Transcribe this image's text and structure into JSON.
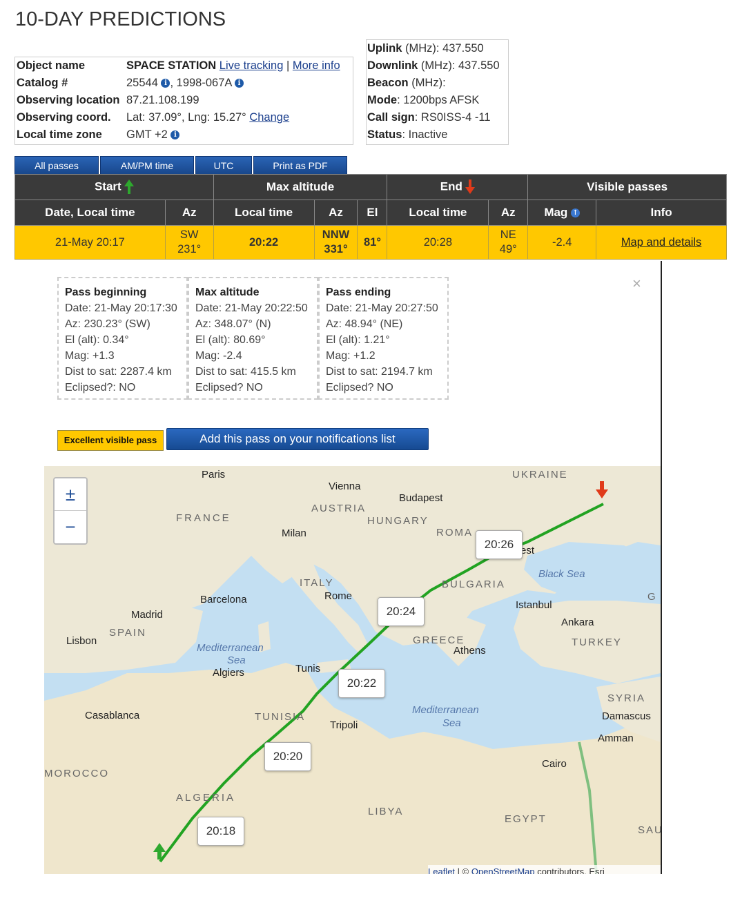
{
  "page_title": "10-DAY PREDICTIONS",
  "object_info": {
    "object_name_label": "Object name",
    "object_name": "SPACE STATION",
    "live_tracking": "Live tracking",
    "separator": "|",
    "more_info": "More info",
    "catalog_label": "Catalog #",
    "catalog_number": "25544",
    "intl_designator": ", 1998-067A",
    "observing_location_label": "Observing location",
    "observing_location": "87.21.108.199",
    "observing_coord_label": "Observing coord.",
    "observing_coord": "Lat: 37.09°, Lng: 15.27°",
    "change_link": "Change",
    "timezone_label": "Local time zone",
    "timezone": "GMT +2"
  },
  "radio": {
    "uplink_label": "Uplink",
    "uplink_value": " (MHz): 437.550",
    "downlink_label": "Downlink",
    "downlink_value": " (MHz): 437.550",
    "beacon_label": "Beacon",
    "beacon_value": " (MHz):",
    "mode_label": "Mode",
    "mode_value": ": 1200bps AFSK",
    "callsign_label": "Call sign",
    "callsign_value": ": RS0ISS-4 -11",
    "status_label": "Status",
    "status_value": ": Inactive"
  },
  "toolbar": {
    "all_passes": "All passes",
    "ampm": "AM/PM time",
    "utc": "UTC",
    "print_pdf": "Print as PDF"
  },
  "passes_table": {
    "group_headers": {
      "start": "Start",
      "max_altitude": "Max altitude",
      "end": "End",
      "visible": "Visible passes"
    },
    "columns": {
      "date_local": "Date, Local time",
      "az1": "Az",
      "local_time_max": "Local time",
      "az_max": "Az",
      "el": "El",
      "local_time_end": "Local time",
      "az_end": "Az",
      "mag": "Mag",
      "info": "Info"
    },
    "row": {
      "date_time": "21-May 20:17",
      "start_dir": "SW",
      "start_az": "231°",
      "max_time": "20:22",
      "max_dir": "NNW",
      "max_az": "331°",
      "max_el": "81°",
      "end_time": "20:28",
      "end_dir": "NE",
      "end_az": "49°",
      "mag": "-2.4",
      "info_link": "Map and details"
    }
  },
  "details": {
    "close": "×",
    "beginning": {
      "title": "Pass beginning",
      "date": "Date: 21-May 20:17:30",
      "az": "Az: 230.23° (SW)",
      "el": "El (alt): 0.34°",
      "mag": "Mag: +1.3",
      "dist": "Dist to sat: 2287.4 km",
      "eclipsed": "Eclipsed?: NO"
    },
    "max": {
      "title": "Max altitude",
      "date": "Date: 21-May 20:22:50",
      "az": "Az: 348.07° (N)",
      "el": "El (alt): 80.69°",
      "mag": "Mag: -2.4",
      "dist": "Dist to sat: 415.5 km",
      "eclipsed": "Eclipsed? NO"
    },
    "ending": {
      "title": "Pass ending",
      "date": "Date: 21-May 20:27:50",
      "az": "Az: 48.94° (NE)",
      "el": "El (alt): 1.21°",
      "mag": "Mag: +1.2",
      "dist": "Dist to sat: 2194.7 km",
      "eclipsed": "Eclipsed? NO"
    },
    "badge": "Excellent visible pass",
    "notify_button": "Add this pass on your notifications list"
  },
  "map": {
    "zoom_in": "±",
    "zoom_out": "−",
    "time_labels": [
      "20:18",
      "20:20",
      "20:22",
      "20:24",
      "20:26"
    ],
    "places": {
      "paris": "Paris",
      "vienna": "Vienna",
      "budapest": "Budapest",
      "ukraine": "UKRAINE",
      "france": "FRANCE",
      "austria": "AUSTRIA",
      "hungary": "HUNGARY",
      "milan": "Milan",
      "roma": "ROMA",
      "est": "est",
      "black_sea": "Black Sea",
      "italy": "ITALY",
      "rome": "Rome",
      "bulgaria": "BULGARIA",
      "barcelona": "Barcelona",
      "istanbul": "Istanbul",
      "g": "G",
      "madrid": "Madrid",
      "spain": "SPAIN",
      "ankara": "Ankara",
      "lisbon": "Lisbon",
      "greece": "GREECE",
      "athens": "Athens",
      "turkey": "TURKEY",
      "med_sea_1": "Mediterranean",
      "sea_1": "Sea",
      "algiers": "Algiers",
      "tunis": "Tunis",
      "syria": "SYRIA",
      "casablanca": "Casablanca",
      "tunisia": "TUNISIA",
      "med_sea_2": "Mediterranean",
      "sea_2": "Sea",
      "damascus": "Damascus",
      "tripoli": "Tripoli",
      "amman": "Amman",
      "morocco": "MOROCCO",
      "cairo": "Cairo",
      "algeria": "ALGERIA",
      "libya": "LIBYA",
      "egypt": "EGYPT",
      "sau": "SAU"
    },
    "attribution_leaflet": "Leaflet",
    "attribution_sep": " | © ",
    "attribution_osm": "OpenStreetMap",
    "attribution_rest": " contributors, Esri",
    "colors": {
      "track": "#22a322",
      "land": "#f2ecd9",
      "desert": "#efe6cc",
      "sea": "#c3dff2",
      "start_arrow": "#2ea82e",
      "end_arrow": "#e03a1a"
    }
  }
}
